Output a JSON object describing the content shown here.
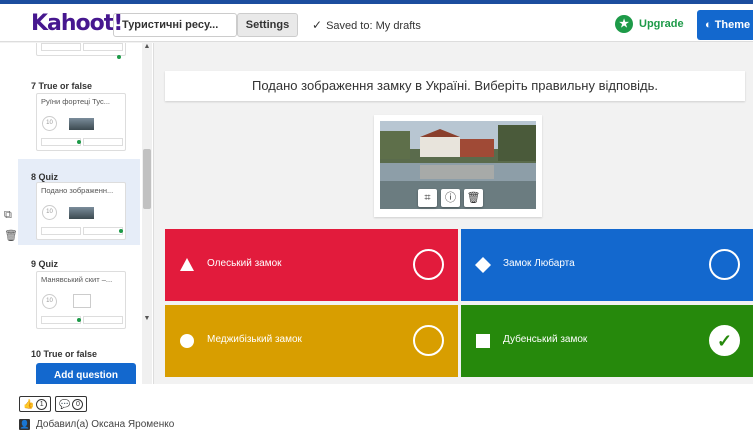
{
  "header": {
    "logo": "Kahoot!",
    "kahoot_title": "Туристичні ресу...",
    "settings_label": "Settings",
    "saved_text": "Saved to: My drafts",
    "upgrade_label": "Upgrade",
    "themes_label": "Theme"
  },
  "sidebar": {
    "slides": [
      {
        "label": "7  True or false",
        "title": "Руїни фортеці Тус...",
        "timer": "10"
      },
      {
        "label": "8  Quiz",
        "title": "Подано зображенн...",
        "timer": "10"
      },
      {
        "label": "9  Quiz",
        "title": "Манявський скит –...",
        "timer": "10"
      },
      {
        "label": "10  True or false"
      }
    ],
    "add_question": "Add question"
  },
  "editor": {
    "question": "Подано зображення замку в Україні. Виберіть правильну відповідь.",
    "answers": [
      {
        "text": "Олеський замок",
        "color": "#e21b3c",
        "shape": "triangle",
        "correct": false
      },
      {
        "text": "Замок Любарта",
        "color": "#1368ce",
        "shape": "diamond",
        "correct": false
      },
      {
        "text": "Меджибізький замок",
        "color": "#d89e00",
        "shape": "circle",
        "correct": false
      },
      {
        "text": "Дубенський замок",
        "color": "#26890c",
        "shape": "square",
        "correct": true
      }
    ],
    "media_tools": [
      "crop-icon",
      "info-icon",
      "trash-icon"
    ]
  },
  "footer": {
    "likes": "1",
    "comments": "0",
    "author": "Добавил(а) Оксана Яроменко"
  }
}
